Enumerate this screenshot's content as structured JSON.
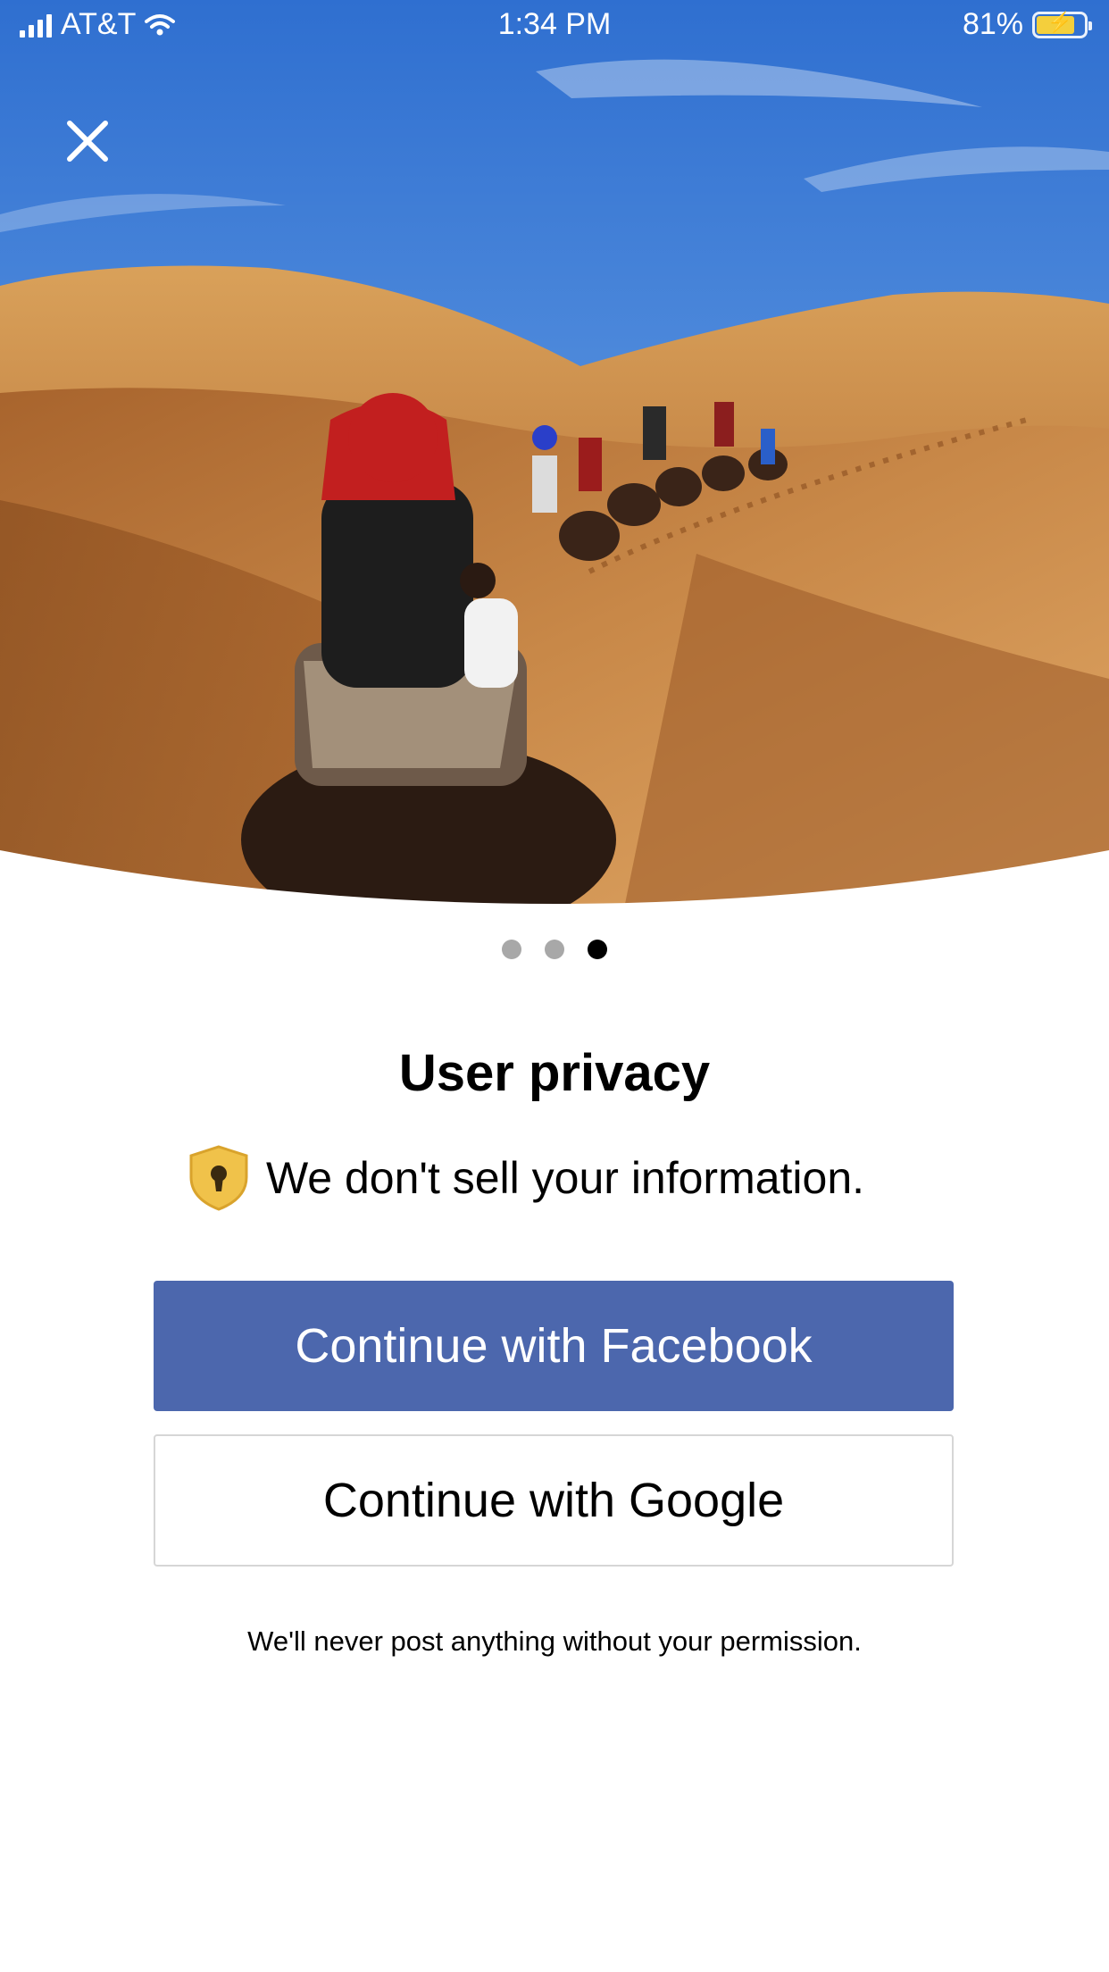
{
  "status_bar": {
    "carrier": "AT&T",
    "time": "1:34 PM",
    "battery_percent": "81%",
    "battery_level": 0.81,
    "battery_color": "#f4cf3c"
  },
  "hero": {
    "close_icon": "close-icon"
  },
  "pager": {
    "count": 3,
    "active_index": 2
  },
  "content": {
    "title": "User privacy",
    "privacy_line": "We don't sell your information.",
    "privacy_icon": "shield-lock-icon",
    "footnote": "We'll never post anything without your permission."
  },
  "buttons": {
    "facebook_label": "Continue with Facebook",
    "google_label": "Continue with Google"
  },
  "colors": {
    "facebook_blue": "#4c67ad",
    "pager_active": "#000000",
    "pager_inactive": "#a8a8a8",
    "shield_gold": "#f0c24a"
  }
}
